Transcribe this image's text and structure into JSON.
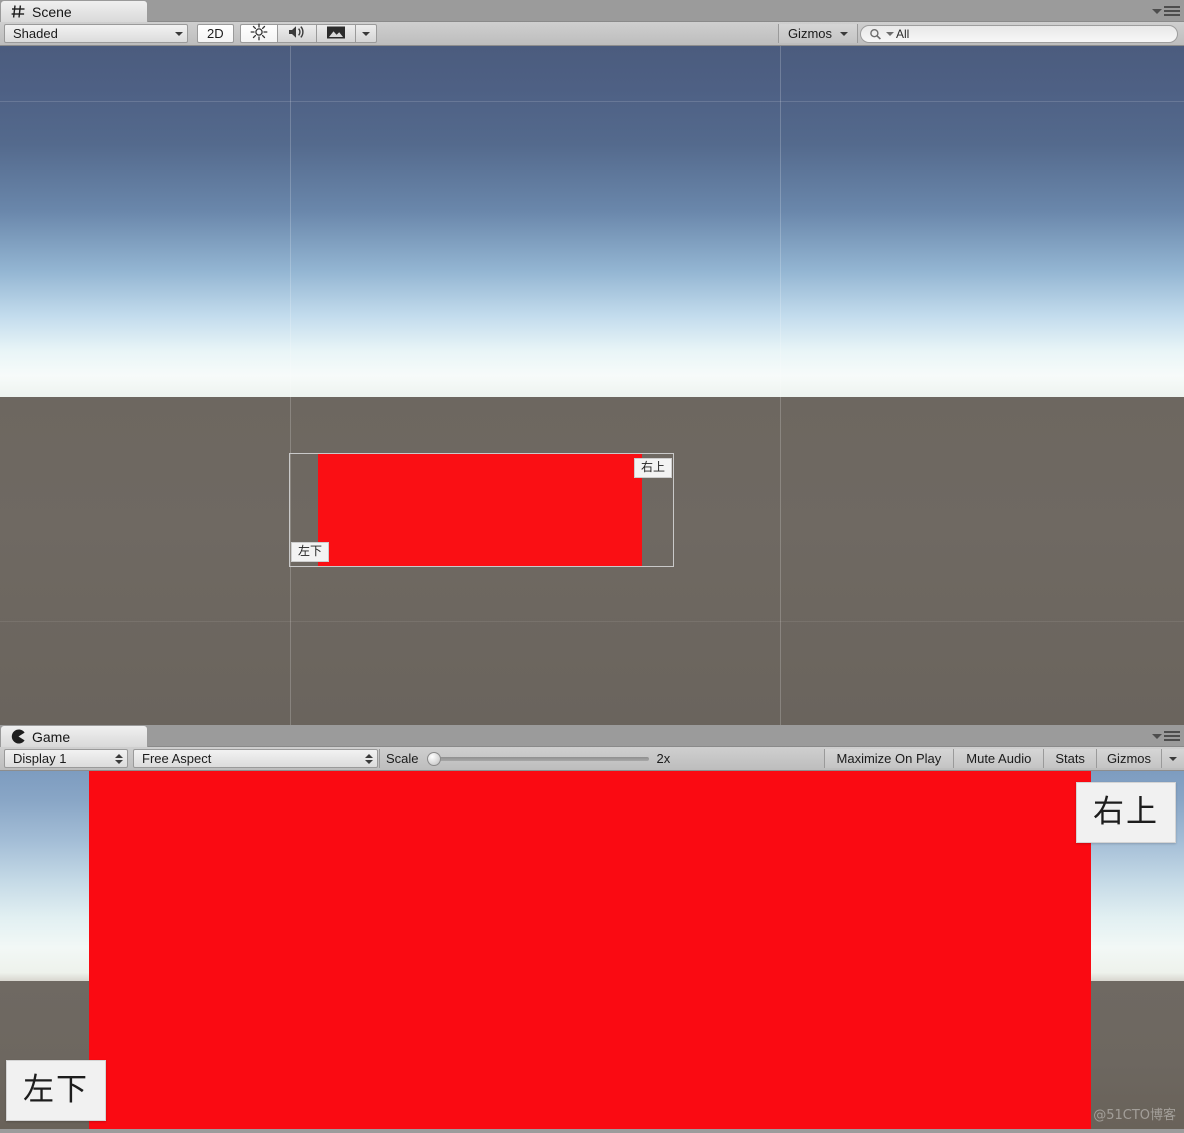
{
  "scene_panel": {
    "tab_label": "Scene",
    "tab_icon": "grid-hash-icon",
    "toolbar": {
      "draw_mode": "Shaded",
      "two_d_button": "2D",
      "lighting_icon": "sun-icon",
      "audio_icon": "speaker-icon",
      "effects_icon": "image-icon",
      "gizmos_label": "Gizmos",
      "search_placeholder": "All",
      "search_value": "All",
      "search_icon": "magnifier-icon"
    },
    "viewport": {
      "labels": [
        {
          "name": "top-right-anchor-label",
          "text": "右上"
        },
        {
          "name": "bottom-left-anchor-label",
          "text": "左下"
        }
      ],
      "rect_color": "#fa0f14",
      "canvas_outline_color": "#c9c9c9"
    },
    "panel_menu_icon": "panel-options-icon"
  },
  "game_panel": {
    "tab_label": "Game",
    "tab_icon": "game-pacman-icon",
    "toolbar": {
      "display": "Display 1",
      "aspect": "Free Aspect",
      "scale_label": "Scale",
      "scale_value": "2x",
      "maximize_on_play": "Maximize On Play",
      "mute_audio": "Mute Audio",
      "stats": "Stats",
      "gizmos_label": "Gizmos"
    },
    "viewport": {
      "labels": [
        {
          "name": "top-right-anchor-label",
          "text": "右上"
        },
        {
          "name": "bottom-left-anchor-label",
          "text": "左下"
        }
      ],
      "rect_color": "#fa0a12",
      "watermark": "@51CTO博客"
    },
    "panel_menu_icon": "panel-options-icon"
  },
  "colors": {
    "chrome": "#9b9b9b",
    "toolbar_top": "#cfcfcf",
    "toolbar_bottom": "#bdbdbd",
    "red_rect": "#fa0f14",
    "ground": "#6e6861",
    "sky_top": "#4b5c7e"
  }
}
